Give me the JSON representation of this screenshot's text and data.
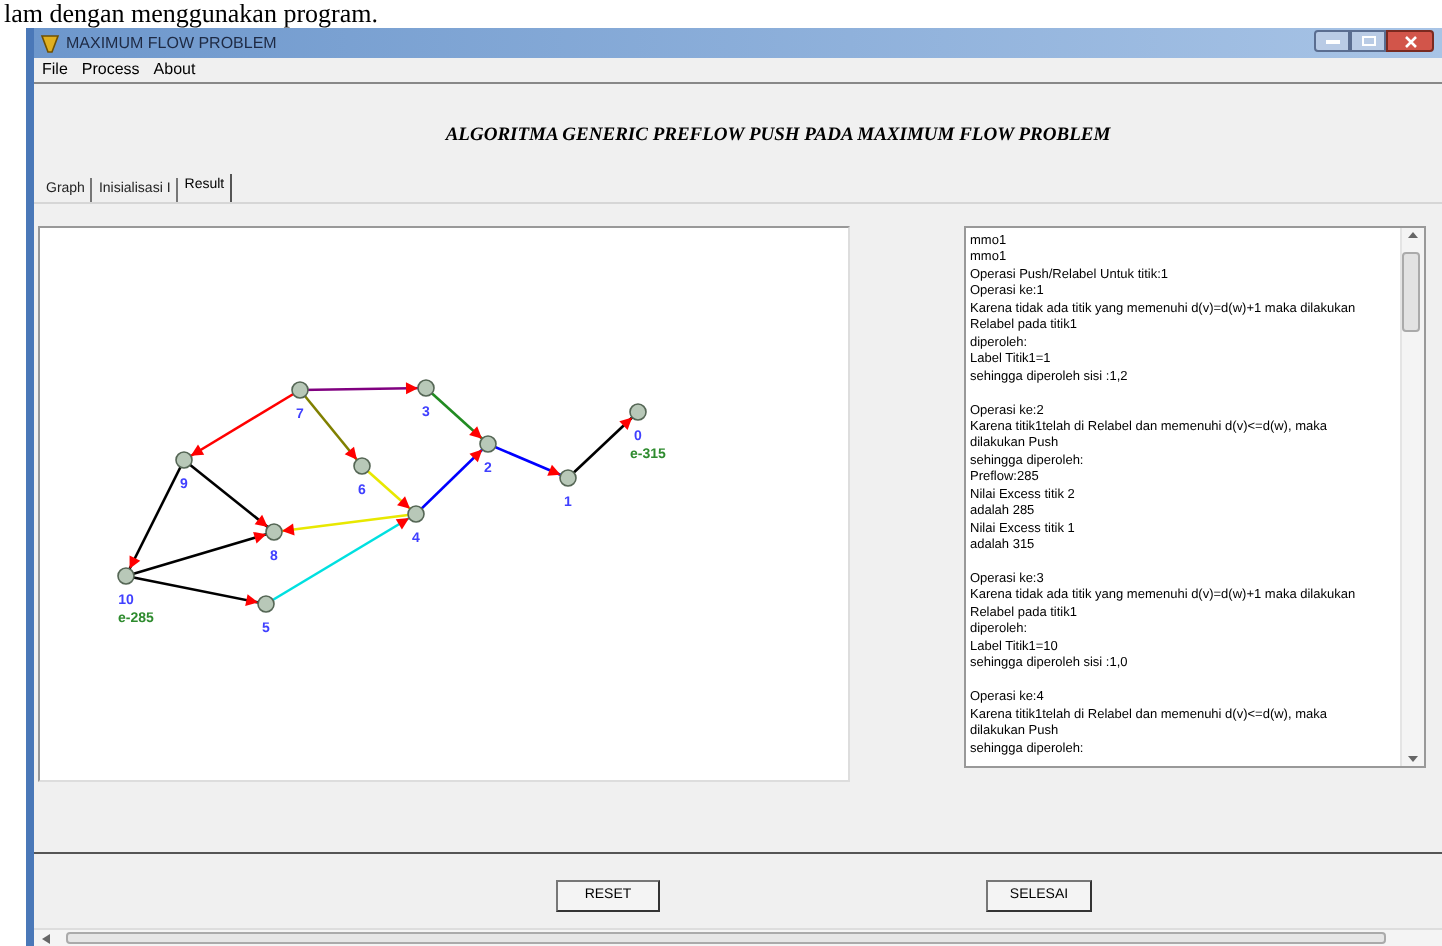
{
  "document_text": "lam dengan menggunakan program.",
  "window": {
    "title": "MAXIMUM FLOW PROBLEM"
  },
  "menu": [
    "File",
    "Process",
    "About"
  ],
  "heading": "ALGORITMA GENERIC PREFLOW PUSH PADA MAXIMUM FLOW PROBLEM",
  "tabs": [
    {
      "label": "Graph",
      "selected": false
    },
    {
      "label": "Inisialisasi I",
      "selected": false
    },
    {
      "label": "Result",
      "selected": true
    }
  ],
  "graph": {
    "nodes": [
      {
        "label": "0",
        "excess": "e-315"
      },
      {
        "label": "1"
      },
      {
        "label": "2"
      },
      {
        "label": "3"
      },
      {
        "label": "4"
      },
      {
        "label": "5"
      },
      {
        "label": "6"
      },
      {
        "label": "7"
      },
      {
        "label": "8"
      },
      {
        "label": "9"
      },
      {
        "label": "10",
        "excess": "e-285"
      }
    ]
  },
  "log": [
    [
      "mmo1",
      "mmo1",
      "Operasi Push/Relabel Untuk titik:1",
      "Operasi ke:1",
      "Karena tidak ada titik yang memenuhi d(v)=d(w)+1 maka dilakukan",
      "Relabel pada titik1",
      "diperoleh:",
      "Label Titik1=1",
      "sehingga diperoleh sisi :1,2"
    ],
    [
      "Operasi ke:2",
      "Karena titik1telah di Relabel dan memenuhi d(v)<=d(w), maka",
      "dilakukan Push",
      "sehingga diperoleh:",
      "Preflow:285",
      "Nilai Excess titik 2",
      "adalah 285",
      "Nilai Excess titik 1",
      "adalah 315"
    ],
    [
      "Operasi ke:3",
      "Karena tidak ada titik yang memenuhi d(v)=d(w)+1 maka dilakukan",
      "Relabel pada titik1",
      "diperoleh:",
      "Label Titik1=10",
      "sehingga diperoleh sisi :1,0"
    ],
    [
      "Operasi ke:4",
      "Karena titik1telah di Relabel dan memenuhi d(v)<=d(w), maka",
      "dilakukan Push",
      "sehingga diperoleh:"
    ]
  ],
  "buttons": [
    "RESET",
    "SELESAI"
  ]
}
